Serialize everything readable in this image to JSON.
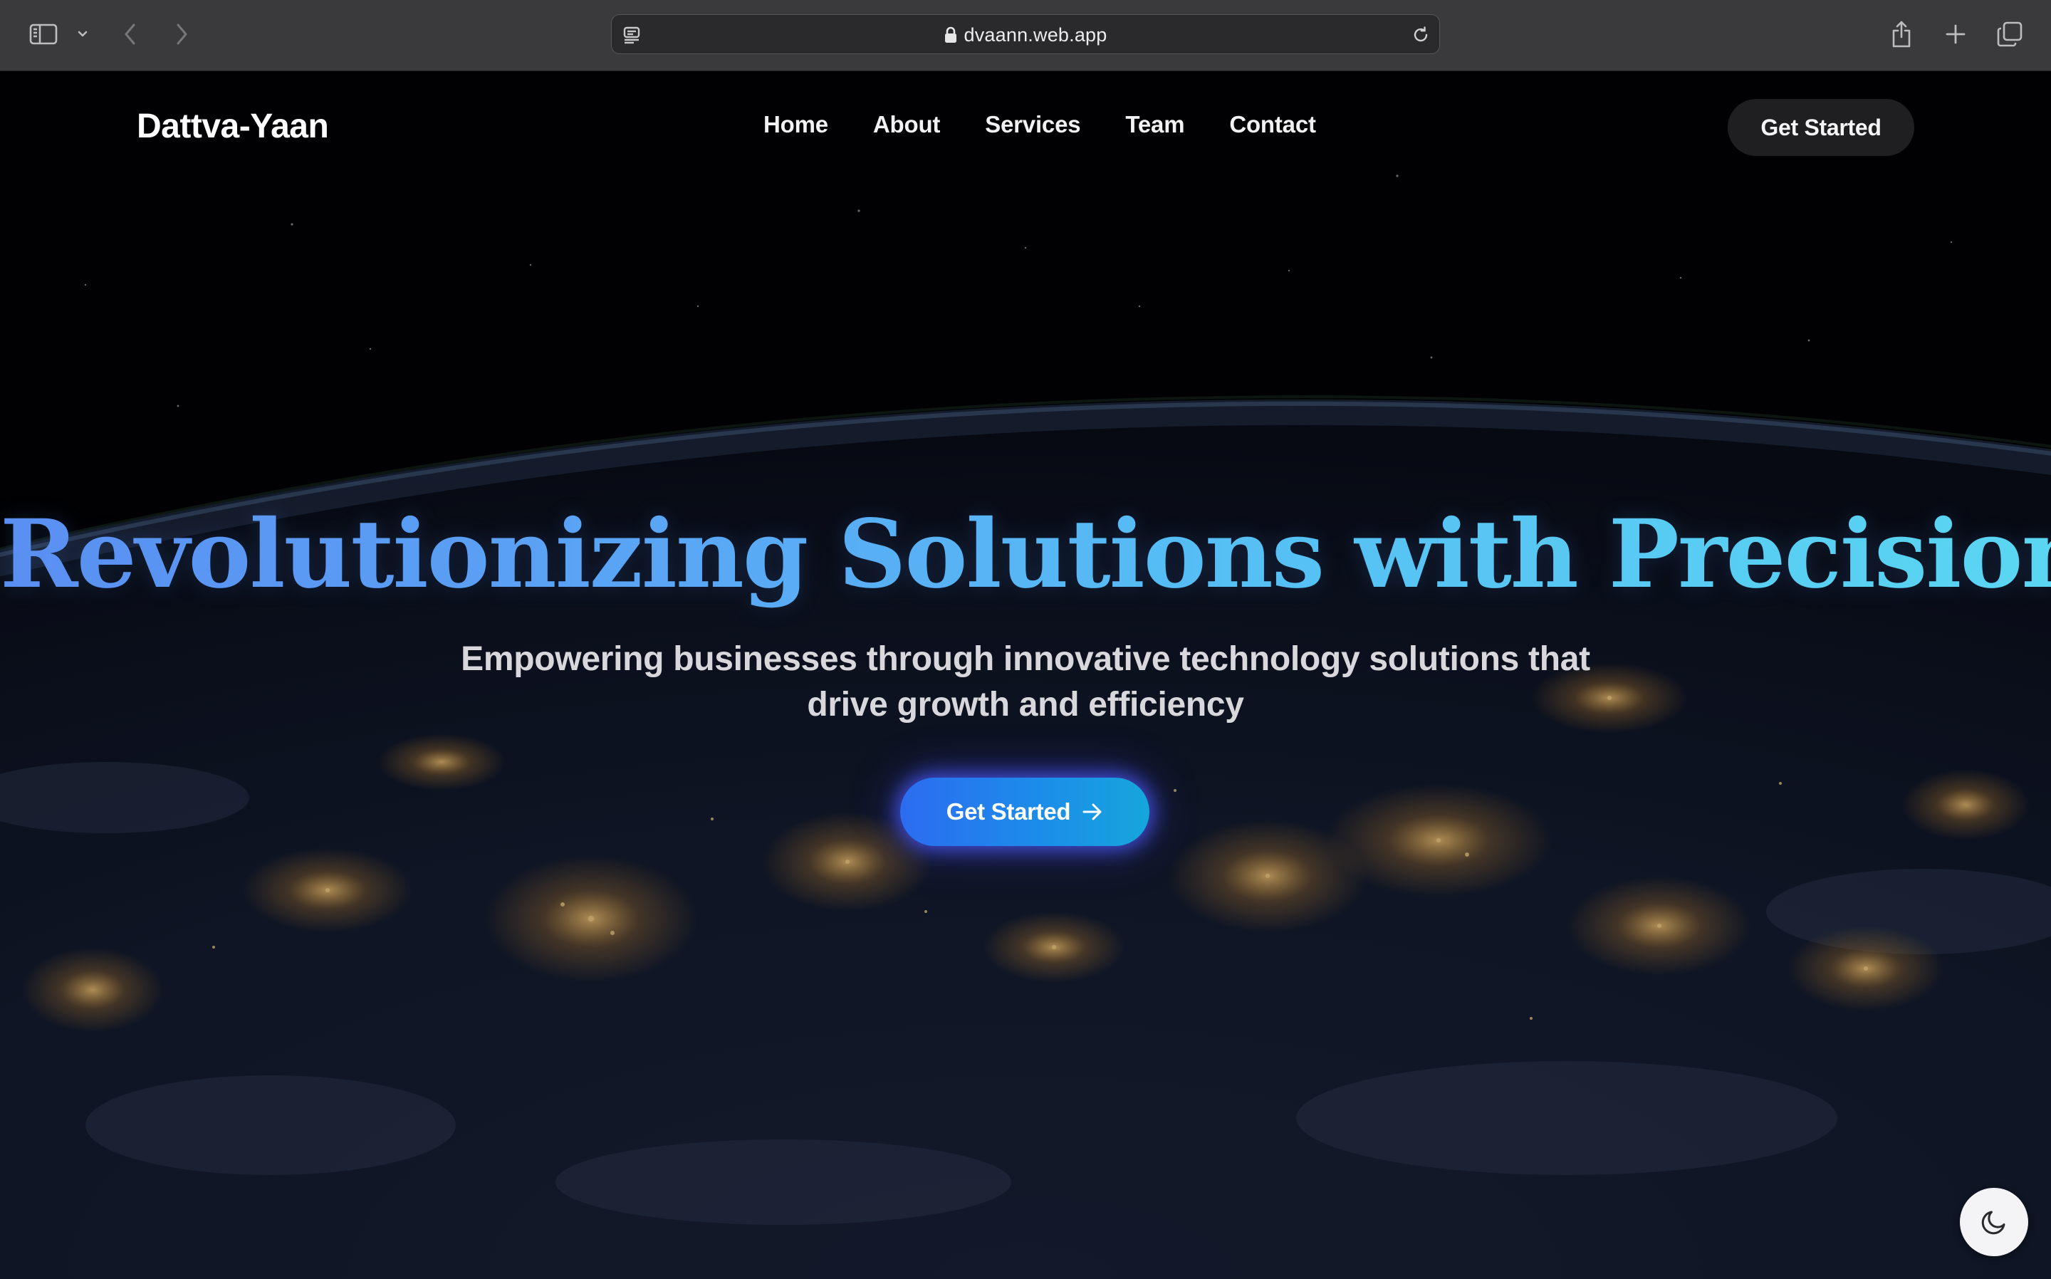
{
  "browser": {
    "url": "dvaann.web.app",
    "icons": {
      "sidebar": "sidebar-icon",
      "sidebar_menu": "chevron-down-icon",
      "back": "chevron-left-icon",
      "forward": "chevron-right-icon",
      "reader": "reader-icon",
      "lock": "lock-icon",
      "reload": "reload-icon",
      "share": "share-icon",
      "new_tab": "plus-icon",
      "tabs_overview": "tabs-icon"
    }
  },
  "site": {
    "logo": "Dattva-Yaan",
    "nav": {
      "items": [
        {
          "label": "Home"
        },
        {
          "label": "About"
        },
        {
          "label": "Services"
        },
        {
          "label": "Team"
        },
        {
          "label": "Contact"
        }
      ],
      "cta_label": "Get Started"
    },
    "hero": {
      "title": "Revolutionizing Solutions with Precision",
      "subtitle": "Empowering businesses through innovative technology solutions that drive growth and efficiency",
      "cta_label": "Get Started",
      "cta_icon": "arrow-right-icon"
    },
    "theme_toggle_icon": "moon-icon"
  },
  "colors": {
    "chrome_bg": "#3a3a3c",
    "page_bg": "#020205",
    "title_gradient_start": "#5a8ff2",
    "title_gradient_end": "#5ad6f2",
    "cta_gradient_start": "#2c6cf0",
    "cta_gradient_end": "#16a6dc",
    "cta_glow": "#5058ff",
    "nav_cta_bg": "#1f1f21",
    "text_primary": "#ffffff",
    "text_secondary": "#d8d8dc"
  }
}
